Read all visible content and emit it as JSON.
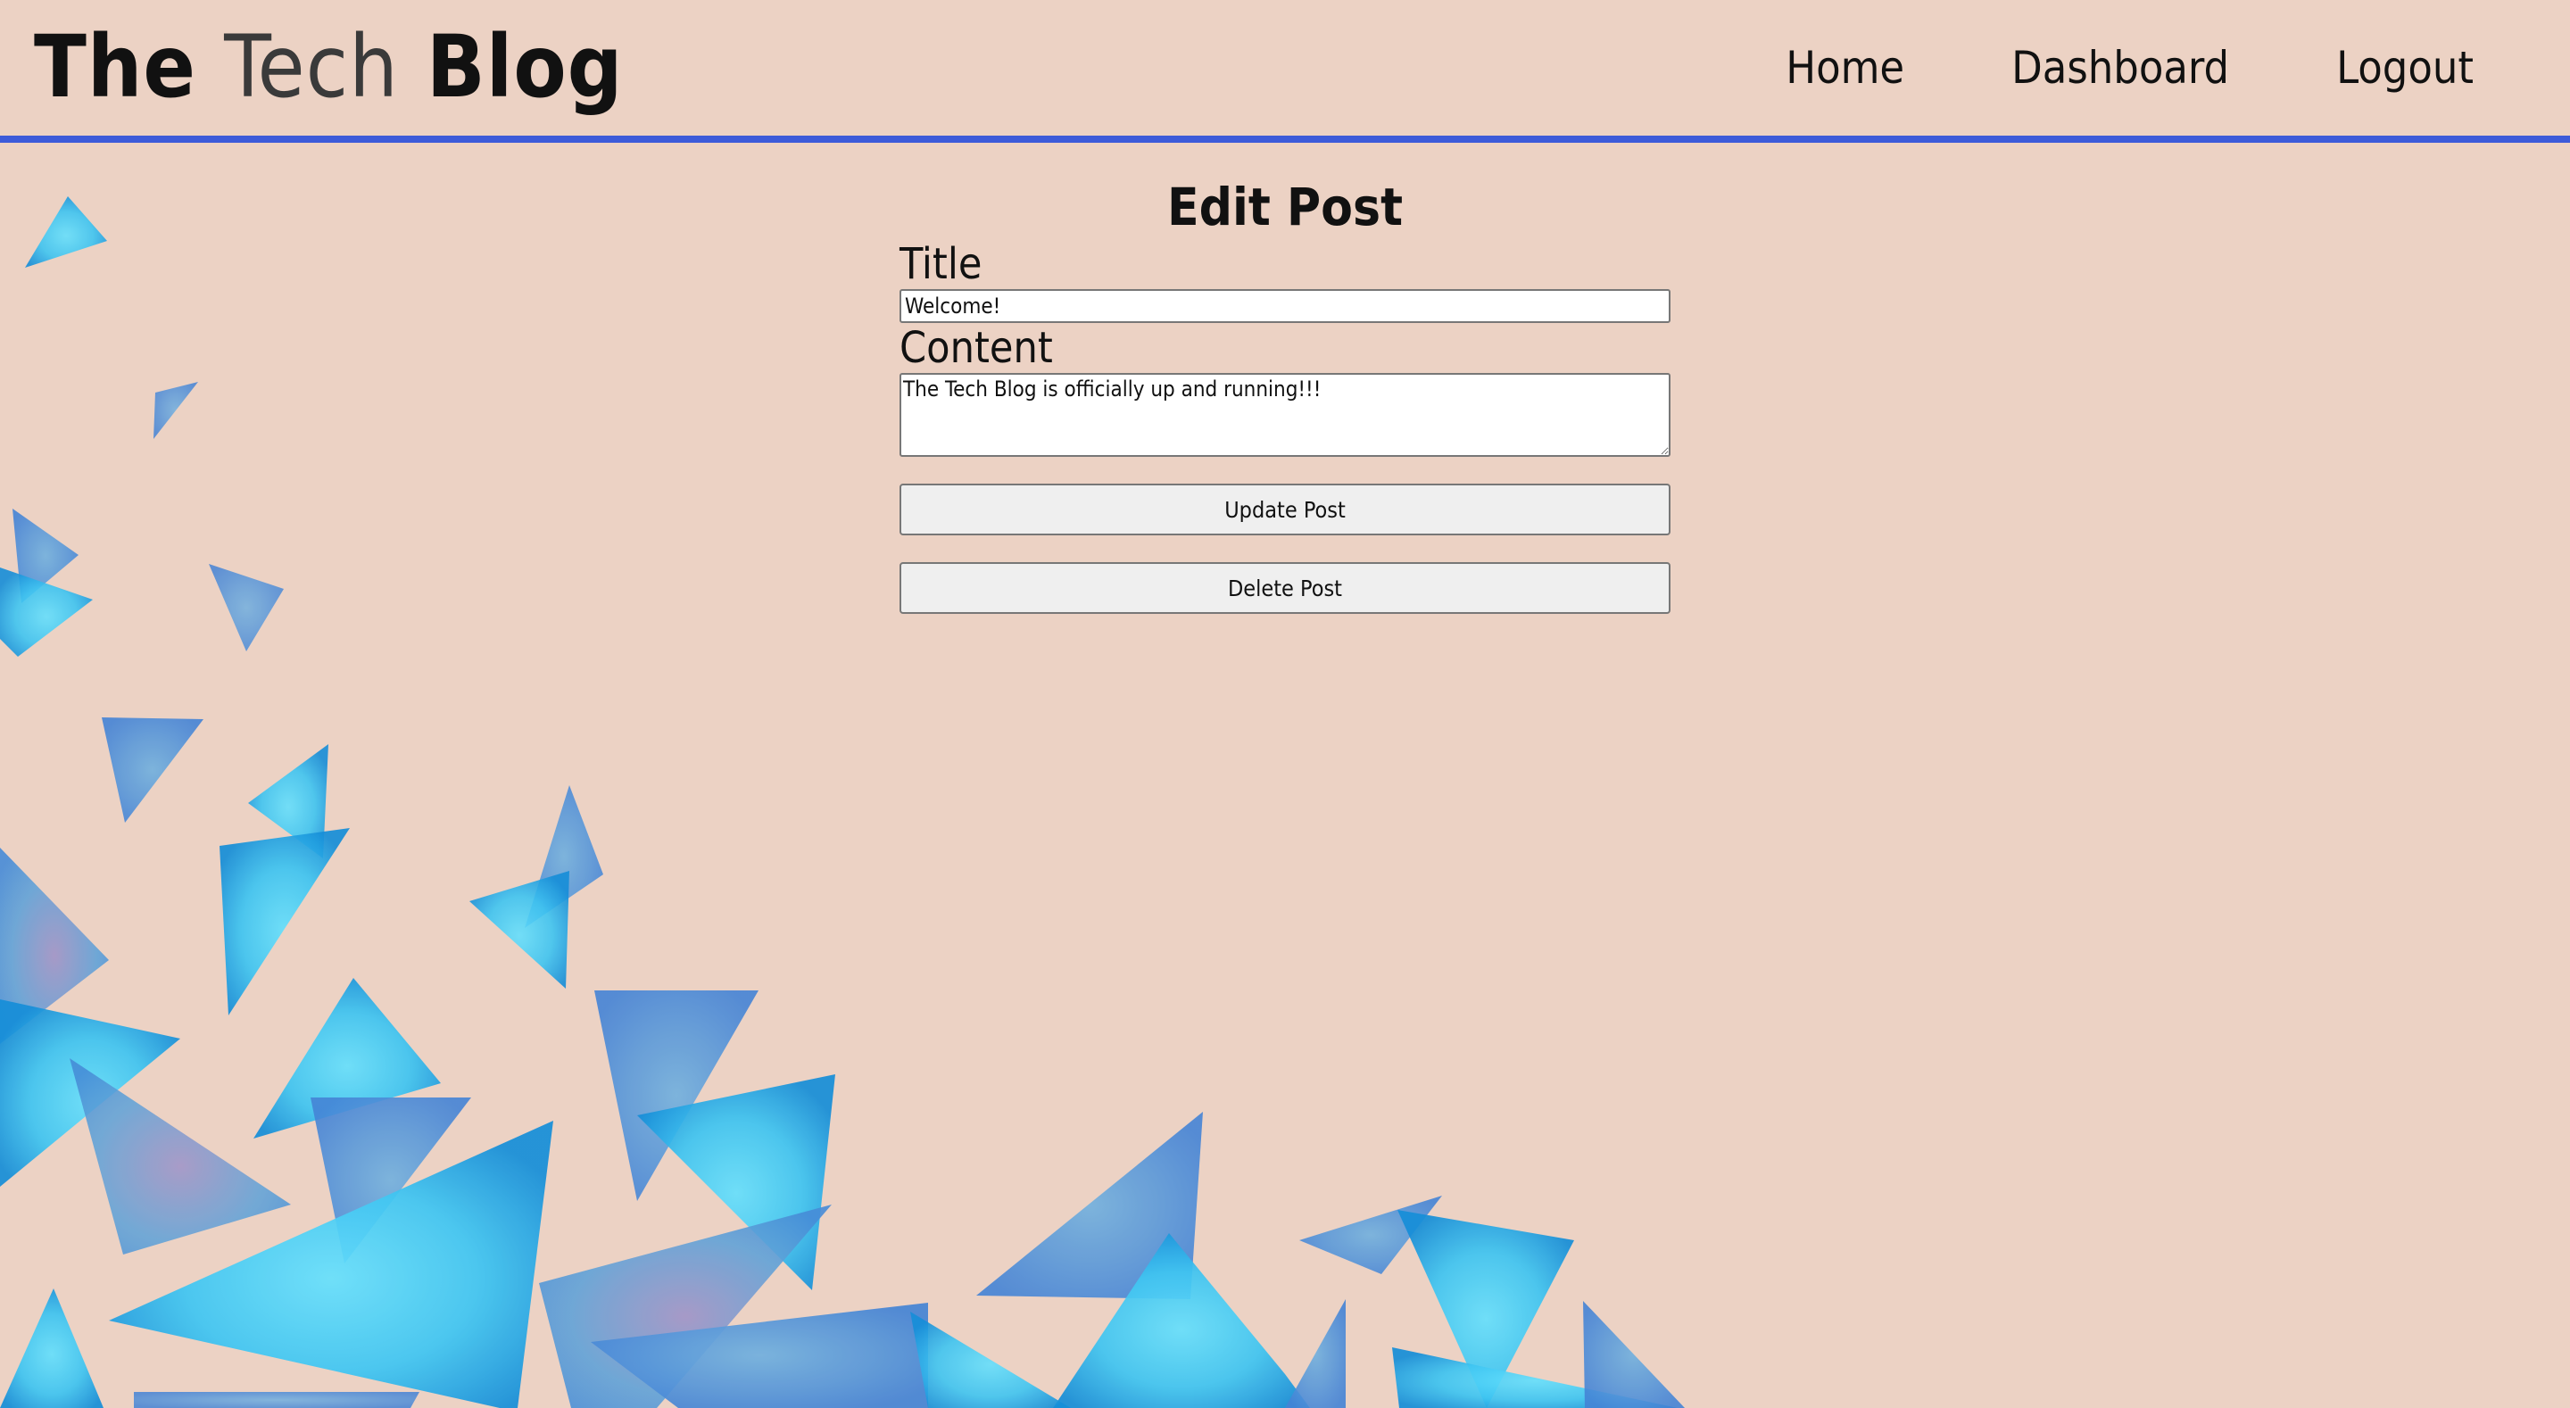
{
  "header": {
    "brand_part1": "The",
    "brand_part2": "Tech",
    "brand_part3": "Blog",
    "nav": {
      "home": "Home",
      "dashboard": "Dashboard",
      "logout": "Logout"
    }
  },
  "form": {
    "heading": "Edit Post",
    "title_label": "Title",
    "title_value": "Welcome!",
    "content_label": "Content",
    "content_value": "The Tech Blog is officially up and running!!!",
    "update_button": "Update Post",
    "delete_button": "Delete Post"
  },
  "colors": {
    "background": "#ecd2c4",
    "header_rule": "#3d5bd9",
    "triangle_light": "#5ad8fa",
    "triangle_dark": "#0b86d8"
  }
}
